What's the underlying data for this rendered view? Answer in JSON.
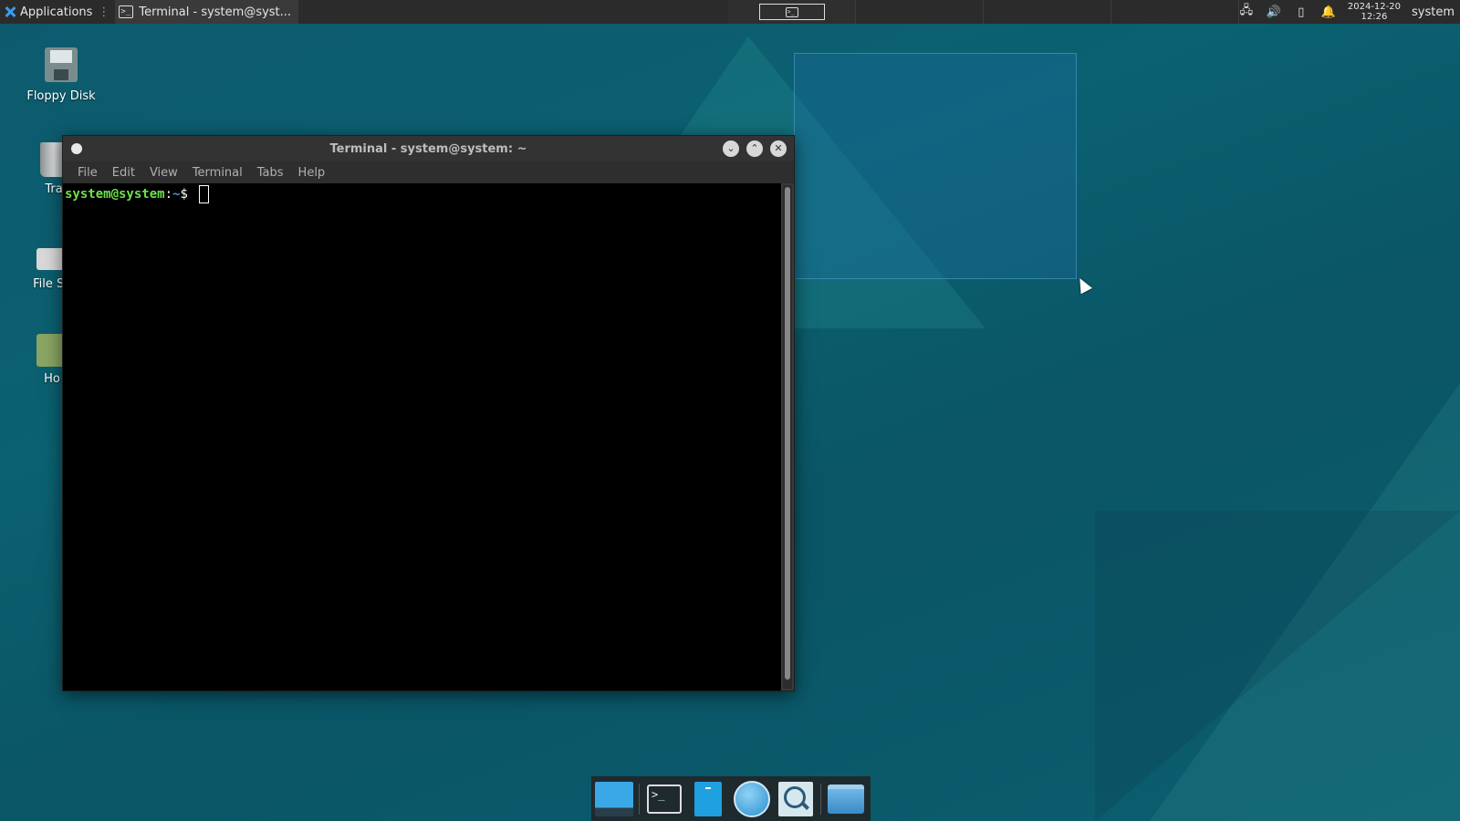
{
  "top_panel": {
    "applications_label": "Applications",
    "separator": "⋮",
    "task_title": "Terminal - system@syst...",
    "clock_date": "2024-12-20",
    "clock_time": "12:26",
    "user": "system"
  },
  "desktop_icons": [
    {
      "label": "Floppy Disk"
    },
    {
      "label": "Tra"
    },
    {
      "label": "File Sy"
    },
    {
      "label": "Ho"
    }
  ],
  "terminal": {
    "title": "Terminal - system@system: ~",
    "menu": [
      "File",
      "Edit",
      "View",
      "Terminal",
      "Tabs",
      "Help"
    ],
    "prompt_user": "system@system",
    "prompt_colon": ":",
    "prompt_path": "~",
    "prompt_symbol": "$"
  },
  "colors": {
    "prompt_user": "#6ee14a",
    "prompt_path": "#5a8fe0",
    "accent": "#3aa7e6"
  },
  "icons": {
    "terminal": "terminal-icon",
    "network": "network-icon",
    "volume": "volume-icon",
    "battery": "battery-icon",
    "notifications": "bell-icon"
  }
}
